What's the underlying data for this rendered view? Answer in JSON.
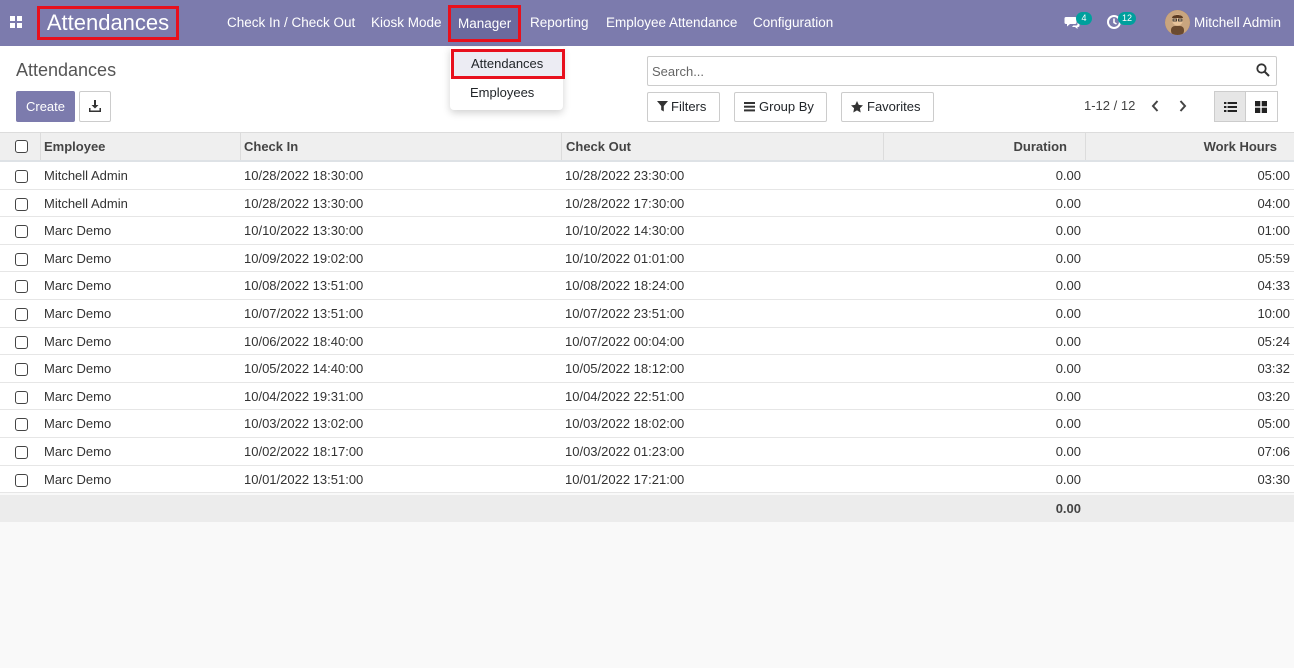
{
  "navbar": {
    "app_title": "Attendances",
    "menu": [
      {
        "label": "Check In / Check Out"
      },
      {
        "label": "Kiosk Mode"
      },
      {
        "label": "Manager"
      },
      {
        "label": "Reporting"
      },
      {
        "label": "Employee Attendance"
      },
      {
        "label": "Configuration"
      }
    ],
    "messages_count": "4",
    "activities_count": "12",
    "user_name": "Mitchell Admin",
    "accent_color": "#7c7bad",
    "badge_color": "#00a09d",
    "highlight_color": "#e8101d"
  },
  "dropdown": {
    "items": [
      {
        "label": "Attendances"
      },
      {
        "label": "Employees"
      }
    ]
  },
  "control_panel": {
    "title": "Attendances",
    "create_label": "Create",
    "search_placeholder": "Search...",
    "filters_label": "Filters",
    "group_by_label": "Group By",
    "favorites_label": "Favorites",
    "pager": "1-12 / 12"
  },
  "table": {
    "headers": {
      "employee": "Employee",
      "check_in": "Check In",
      "check_out": "Check Out",
      "duration": "Duration",
      "work_hours": "Work Hours"
    },
    "rows": [
      {
        "employee": "Mitchell Admin",
        "check_in": "10/28/2022 18:30:00",
        "check_out": "10/28/2022 23:30:00",
        "duration": "0.00",
        "work_hours": "05:00"
      },
      {
        "employee": "Mitchell Admin",
        "check_in": "10/28/2022 13:30:00",
        "check_out": "10/28/2022 17:30:00",
        "duration": "0.00",
        "work_hours": "04:00"
      },
      {
        "employee": "Marc Demo",
        "check_in": "10/10/2022 13:30:00",
        "check_out": "10/10/2022 14:30:00",
        "duration": "0.00",
        "work_hours": "01:00"
      },
      {
        "employee": "Marc Demo",
        "check_in": "10/09/2022 19:02:00",
        "check_out": "10/10/2022 01:01:00",
        "duration": "0.00",
        "work_hours": "05:59"
      },
      {
        "employee": "Marc Demo",
        "check_in": "10/08/2022 13:51:00",
        "check_out": "10/08/2022 18:24:00",
        "duration": "0.00",
        "work_hours": "04:33"
      },
      {
        "employee": "Marc Demo",
        "check_in": "10/07/2022 13:51:00",
        "check_out": "10/07/2022 23:51:00",
        "duration": "0.00",
        "work_hours": "10:00"
      },
      {
        "employee": "Marc Demo",
        "check_in": "10/06/2022 18:40:00",
        "check_out": "10/07/2022 00:04:00",
        "duration": "0.00",
        "work_hours": "05:24"
      },
      {
        "employee": "Marc Demo",
        "check_in": "10/05/2022 14:40:00",
        "check_out": "10/05/2022 18:12:00",
        "duration": "0.00",
        "work_hours": "03:32"
      },
      {
        "employee": "Marc Demo",
        "check_in": "10/04/2022 19:31:00",
        "check_out": "10/04/2022 22:51:00",
        "duration": "0.00",
        "work_hours": "03:20"
      },
      {
        "employee": "Marc Demo",
        "check_in": "10/03/2022 13:02:00",
        "check_out": "10/03/2022 18:02:00",
        "duration": "0.00",
        "work_hours": "05:00"
      },
      {
        "employee": "Marc Demo",
        "check_in": "10/02/2022 18:17:00",
        "check_out": "10/03/2022 01:23:00",
        "duration": "0.00",
        "work_hours": "07:06"
      },
      {
        "employee": "Marc Demo",
        "check_in": "10/01/2022 13:51:00",
        "check_out": "10/01/2022 17:21:00",
        "duration": "0.00",
        "work_hours": "03:30"
      }
    ],
    "total_duration": "0.00"
  }
}
